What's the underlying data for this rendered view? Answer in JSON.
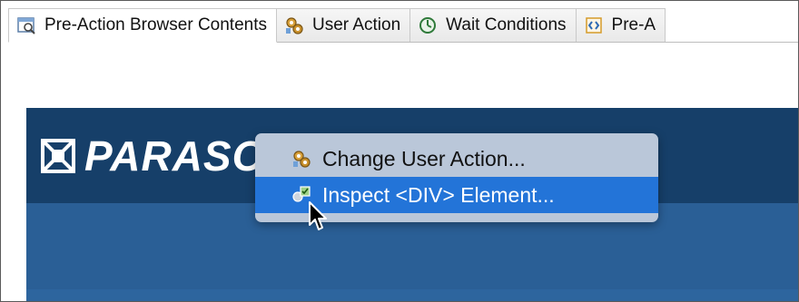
{
  "tabs": [
    {
      "label": "Pre-Action Browser Contents",
      "active": true,
      "icon": "browser-page-icon"
    },
    {
      "label": "User Action",
      "active": false,
      "icon": "gears-icon"
    },
    {
      "label": "Wait Conditions",
      "active": false,
      "icon": "clock-icon"
    },
    {
      "label": "Pre-A",
      "active": false,
      "icon": "code-icon"
    }
  ],
  "browser": {
    "logo_text": "PARASOFT",
    "colors": {
      "header": "#163f69",
      "band": "#2a5f96"
    }
  },
  "context_menu": {
    "items": [
      {
        "label": "Change User Action...",
        "icon": "gears-icon",
        "highlighted": false
      },
      {
        "label": "Inspect <DIV> Element...",
        "icon": "inspect-icon",
        "highlighted": true
      }
    ],
    "highlight_color": "#2374d8"
  }
}
